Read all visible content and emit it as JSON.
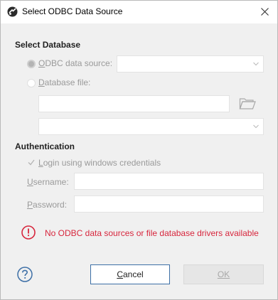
{
  "window": {
    "title": "Select ODBC Data Source"
  },
  "select_database": {
    "header": "Select Database",
    "odbc_option_label": "ODBC data source:",
    "odbc_option_selected": true,
    "odbc_value": "",
    "file_option_label": "Database file:",
    "file_option_selected": false,
    "file_path_value": "",
    "driver_value": ""
  },
  "authentication": {
    "header": "Authentication",
    "windows_login_label": "Login using windows credentials",
    "windows_login_checked": true,
    "username_label": "Username:",
    "username_value": "",
    "password_label": "Password:",
    "password_value": ""
  },
  "error": {
    "message": "No ODBC data sources or file database drivers available"
  },
  "buttons": {
    "cancel": "Cancel",
    "ok": "OK"
  },
  "colors": {
    "error": "#d7263d",
    "accent": "#3d6fa6",
    "disabled_text": "#9a9a9a"
  },
  "icons": [
    "app-icon",
    "close-icon",
    "chevron-down-icon",
    "folder-icon",
    "checkmark-icon",
    "error-icon",
    "help-icon"
  ]
}
